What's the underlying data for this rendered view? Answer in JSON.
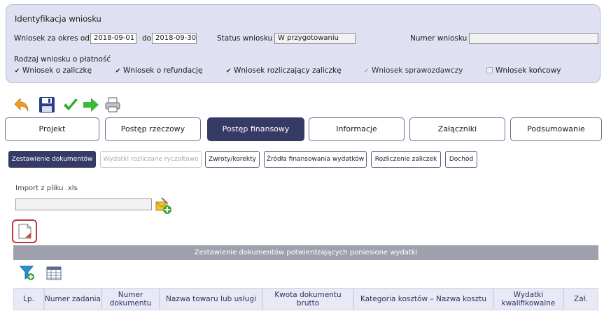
{
  "identification": {
    "title": "Identyfikacja wniosku",
    "period_from_label": "Wniosek za okres od",
    "period_from_value": "2018-09-01",
    "period_to_label": "do",
    "period_to_value": "2018-09-30",
    "status_label": "Status wniosku",
    "status_value": "W przygotowaniu",
    "number_label": "Numer wniosku",
    "number_value": "",
    "payment_type_label": "Rodzaj wniosku o płatność",
    "checkboxes": [
      {
        "label": "Wniosek o zaliczkę",
        "checked": true,
        "disabled": false
      },
      {
        "label": "Wniosek o refundację",
        "checked": true,
        "disabled": false
      },
      {
        "label": "Wniosek rozliczający zaliczkę",
        "checked": true,
        "disabled": false
      },
      {
        "label": "Wniosek sprawozdawczy",
        "checked": true,
        "disabled": true
      },
      {
        "label": "Wniosek końcowy",
        "checked": false,
        "disabled": true
      }
    ]
  },
  "toolbar": [
    "undo-icon",
    "save-icon",
    "check-icon",
    "forward-icon",
    "print-icon"
  ],
  "main_tabs": [
    {
      "label": "Projekt",
      "active": false
    },
    {
      "label": "Postęp rzeczowy",
      "active": false
    },
    {
      "label": "Postęp finansowy",
      "active": true
    },
    {
      "label": "Informacje",
      "active": false
    },
    {
      "label": "Załączniki",
      "active": false
    },
    {
      "label": "Podsumowanie",
      "active": false
    }
  ],
  "sub_tabs": [
    {
      "label": "Zestawienie dokumentów",
      "state": "active"
    },
    {
      "label": "Wydatki rozliczane ryczałtowo",
      "state": "disabled"
    },
    {
      "label": "Zwroty/korekty",
      "state": "normal"
    },
    {
      "label": "Źródła finansowania wydatków",
      "state": "normal"
    },
    {
      "label": "Rozliczenie zaliczek",
      "state": "normal"
    },
    {
      "label": "Dochód",
      "state": "normal"
    }
  ],
  "import": {
    "label": "Import z pliku .xls",
    "value": ""
  },
  "section_title": "Zestawienie dokumentów potwierdzających poniesione wydatki",
  "table_headers": [
    "Lp.",
    "Numer zadania",
    "Numer dokumentu",
    "Nazwa towaru lub usługi",
    "Kwota dokumentu brutto",
    "Kategoria kosztów – Nazwa kosztu",
    "Wydatki kwalifikowalne",
    "Zał."
  ],
  "colors": {
    "panel_bg": "#dfe1f2",
    "active_tab": "#363b65",
    "section_bar": "#9fa0ad",
    "header_bg": "#e7e9f5",
    "header_text": "#2f3464"
  }
}
